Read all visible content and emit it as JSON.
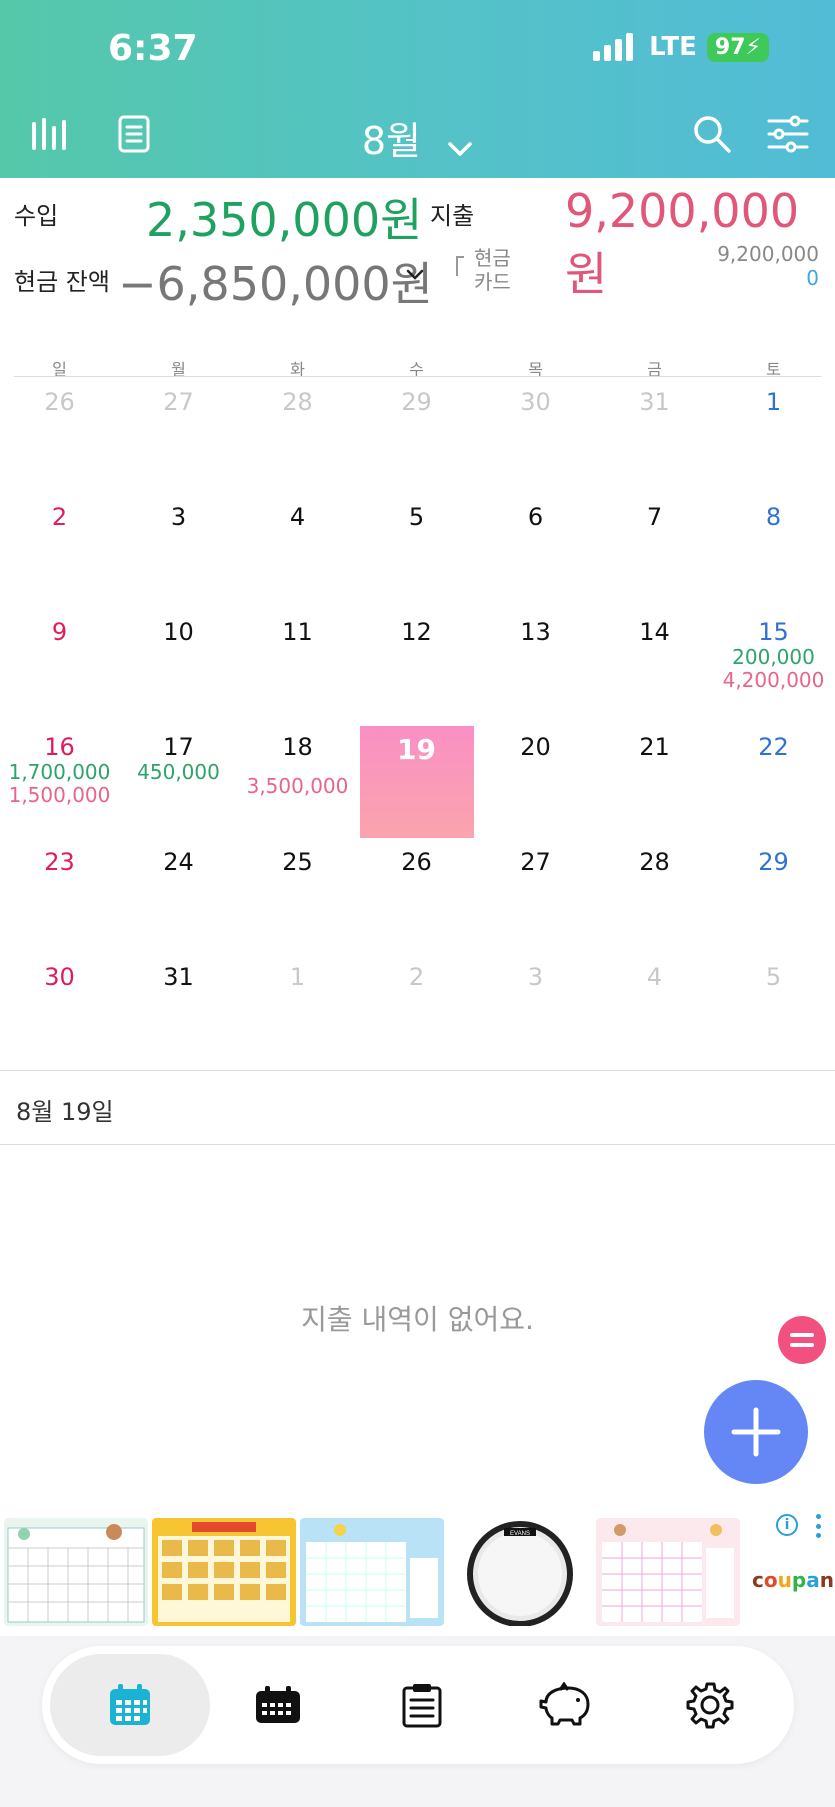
{
  "status_bar": {
    "time": "6:37",
    "network": "LTE",
    "battery": "97"
  },
  "header": {
    "month": "8월",
    "icons": [
      "stats-icon",
      "list-icon",
      "chevron-down-icon",
      "search-icon",
      "filter-icon"
    ]
  },
  "summary": {
    "income_label": "수입",
    "income_value": "2,350,000원",
    "expense_label": "지출",
    "expense_value": "9,200,000원",
    "balance_label": "현금 잔액",
    "balance_value": "−6,850,000원",
    "cash_label": "현금",
    "card_label": "카드",
    "cash_value": "9,200,000",
    "card_value": "0"
  },
  "calendar": {
    "weekdays": [
      "일",
      "월",
      "화",
      "수",
      "목",
      "금",
      "토"
    ],
    "weeks": [
      [
        {
          "d": "26",
          "dim": true
        },
        {
          "d": "27",
          "dim": true
        },
        {
          "d": "28",
          "dim": true
        },
        {
          "d": "29",
          "dim": true
        },
        {
          "d": "30",
          "dim": true
        },
        {
          "d": "31",
          "dim": true
        },
        {
          "d": "1"
        }
      ],
      [
        {
          "d": "2"
        },
        {
          "d": "3"
        },
        {
          "d": "4"
        },
        {
          "d": "5"
        },
        {
          "d": "6"
        },
        {
          "d": "7"
        },
        {
          "d": "8"
        }
      ],
      [
        {
          "d": "9"
        },
        {
          "d": "10"
        },
        {
          "d": "11"
        },
        {
          "d": "12"
        },
        {
          "d": "13"
        },
        {
          "d": "14"
        },
        {
          "d": "15",
          "inc": "200,000",
          "exp": "4,200,000"
        }
      ],
      [
        {
          "d": "16",
          "inc": "1,700,000",
          "exp": "1,500,000"
        },
        {
          "d": "17",
          "inc": "450,000"
        },
        {
          "d": "18",
          "exp": "3,500,000"
        },
        {
          "d": "19",
          "today": true
        },
        {
          "d": "20"
        },
        {
          "d": "21"
        },
        {
          "d": "22"
        }
      ],
      [
        {
          "d": "23"
        },
        {
          "d": "24"
        },
        {
          "d": "25"
        },
        {
          "d": "26"
        },
        {
          "d": "27"
        },
        {
          "d": "28"
        },
        {
          "d": "29"
        }
      ],
      [
        {
          "d": "30"
        },
        {
          "d": "31"
        },
        {
          "d": "1",
          "dim": true
        },
        {
          "d": "2",
          "dim": true
        },
        {
          "d": "3",
          "dim": true
        },
        {
          "d": "4",
          "dim": true
        },
        {
          "d": "5",
          "dim": true
        }
      ]
    ]
  },
  "selected_date": "8월 19일",
  "empty_message": "지출 내역이 없어요.",
  "ad": {
    "brand": "coupang",
    "drum_brand": "EVANS"
  },
  "tabs": [
    {
      "name": "calendar",
      "icon": "calendar-month-icon",
      "active": true
    },
    {
      "name": "week",
      "icon": "calendar-week-icon",
      "active": false
    },
    {
      "name": "notes",
      "icon": "clipboard-icon",
      "active": false
    },
    {
      "name": "savings",
      "icon": "piggy-bank-icon",
      "active": false
    },
    {
      "name": "settings",
      "icon": "gear-icon",
      "active": false
    }
  ],
  "colors": {
    "header_gradient_start": "#55c8aa",
    "header_gradient_end": "#52bcd6",
    "income": "#1fa15f",
    "expense": "#e0577a",
    "sunday": "#e21b5b",
    "saturday": "#2f73d0",
    "today_start": "#f990c4",
    "today_end": "#fba4ad",
    "fab": "#6487f5",
    "fab_small": "#f2517f",
    "active_tab": "#1bb3d4"
  }
}
